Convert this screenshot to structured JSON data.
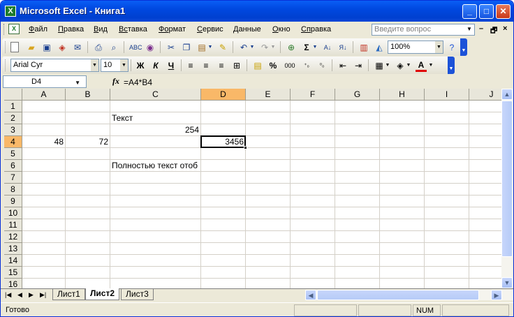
{
  "window": {
    "app_icon": "X",
    "title": "Microsoft Excel - Книга1",
    "min": "_",
    "max": "□",
    "close": "✕"
  },
  "menubar": {
    "doc_icon": "X",
    "items": [
      {
        "u": "Ф",
        "rest": "айл"
      },
      {
        "u": "П",
        "rest": "равка"
      },
      {
        "u": "В",
        "rest": "ид"
      },
      {
        "u": "Вс",
        "rest": "тавка"
      },
      {
        "u": "Фо",
        "rest": "рмат"
      },
      {
        "u": "С",
        "rest": "ервис"
      },
      {
        "u": "Д",
        "rest": "анные"
      },
      {
        "u": "О",
        "rest": "кно"
      },
      {
        "u": "Сп",
        "rest": "равка"
      }
    ],
    "help_placeholder": "Введите вопрос",
    "mdi_min": "–",
    "mdi_restore": "🗗",
    "mdi_close": "×"
  },
  "standard_toolbar": {
    "zoom": "100%"
  },
  "formatting_toolbar": {
    "font": "Arial Cyr",
    "size": "10",
    "bold": "Ж",
    "italic": "К",
    "underline": "Ч",
    "percent": "%",
    "thousands": "000",
    "font_color": "A"
  },
  "formula_bar": {
    "name_box": "D4",
    "fx": "fx",
    "formula": "=A4*B4"
  },
  "grid": {
    "columns": [
      "A",
      "B",
      "C",
      "D",
      "E",
      "F",
      "G",
      "H",
      "I",
      "J"
    ],
    "rows": [
      "1",
      "2",
      "3",
      "4",
      "5",
      "6",
      "7",
      "8",
      "9",
      "10",
      "11",
      "12",
      "13",
      "14",
      "15",
      "16"
    ],
    "active_cell": "D4",
    "cells": {
      "C2": "Текст",
      "C3": "254",
      "A4": "48",
      "B4": "72",
      "D4": "3456",
      "C6": "Полностью текст отоб"
    }
  },
  "sheets": [
    "Лист1",
    "Лист2",
    "Лист3"
  ],
  "active_sheet": "Лист2",
  "status": {
    "left": "Готово",
    "num": "NUM"
  },
  "colors": {
    "title_blue": "#0a5ef5",
    "selection_header": "#f9b868",
    "face": "#ece9d8"
  },
  "icons": [
    "new-icon",
    "open-icon",
    "save-icon",
    "permission-icon",
    "email-icon",
    "print-icon",
    "print-preview-icon",
    "spelling-icon",
    "research-icon",
    "cut-icon",
    "copy-icon",
    "paste-icon",
    "format-painter-icon",
    "undo-icon",
    "redo-icon",
    "hyperlink-icon",
    "autosum-icon",
    "sort-ascending-icon",
    "sort-descending-icon",
    "chart-wizard-icon",
    "drawing-icon",
    "help-icon"
  ]
}
